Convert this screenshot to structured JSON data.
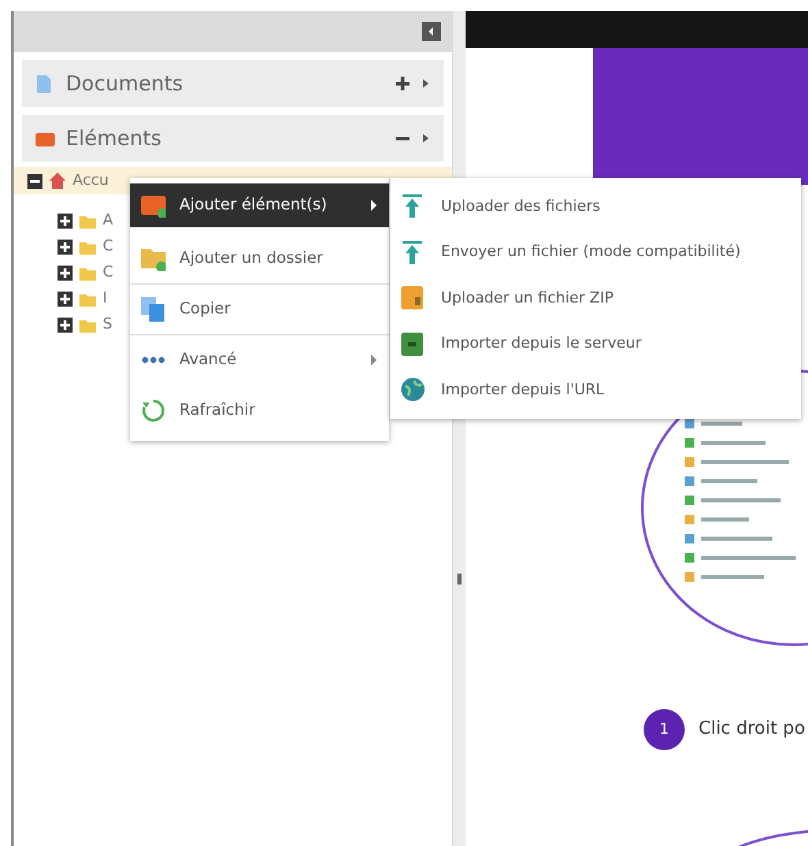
{
  "sidebar": {
    "sections": [
      {
        "label": "Documents",
        "expanded": false
      },
      {
        "label": "Eléments",
        "expanded": true
      }
    ],
    "tree": [
      {
        "label": "Accu",
        "expanded": true,
        "selected": true,
        "children": [
          {
            "label": "A",
            "expanded": false
          },
          {
            "label": "C",
            "expanded": false
          },
          {
            "label": "C",
            "expanded": false
          },
          {
            "label": "I",
            "expanded": false
          },
          {
            "label": "S",
            "expanded": false
          }
        ]
      }
    ]
  },
  "context_menu": {
    "items": [
      {
        "label": "Ajouter élément(s)",
        "selected": true,
        "has_submenu": true,
        "separated": false
      },
      {
        "label": "Ajouter un dossier",
        "selected": false,
        "has_submenu": false,
        "separated": false
      },
      {
        "label": "Copier",
        "selected": false,
        "has_submenu": false,
        "separated": true
      },
      {
        "label": "Avancé",
        "selected": false,
        "has_submenu": true,
        "separated": true
      },
      {
        "label": "Rafraîchir",
        "selected": false,
        "has_submenu": false,
        "separated": false
      }
    ]
  },
  "submenu": {
    "items": [
      {
        "label": "Uploader des fichiers"
      },
      {
        "label": "Envoyer un fichier (mode compatibilité)"
      },
      {
        "label": "Uploader un fichier ZIP"
      },
      {
        "label": "Importer depuis le serveur"
      },
      {
        "label": "Importer depuis l'URL"
      }
    ]
  },
  "step": {
    "number": "1",
    "text": "Clic droit po"
  }
}
